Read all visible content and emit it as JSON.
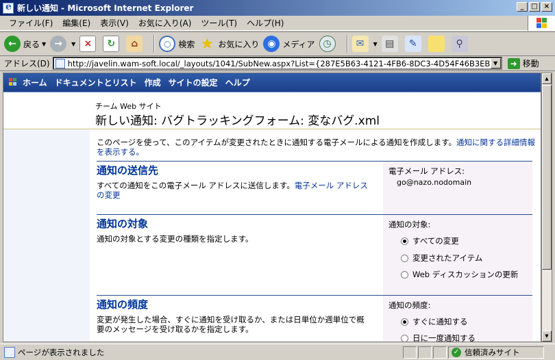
{
  "window": {
    "title": "新しい通知 - Microsoft Internet Explorer"
  },
  "menu": [
    "ファイル(F)",
    "編集(E)",
    "表示(V)",
    "お気に入り(A)",
    "ツール(T)",
    "ヘルプ(H)"
  ],
  "toolbar": {
    "back": "戻る",
    "search": "検索",
    "favorites": "お気に入り",
    "media": "メディア"
  },
  "address": {
    "label": "アドレス(D)",
    "url": "http://javelin.wam-soft.local/_layouts/1041/SubNew.aspx?List={287E5B63-4121-4FB6-8DC3-4D54F46B3EB2}&ID=1",
    "go": "移動"
  },
  "sp_nav": [
    "ホーム",
    "ドキュメントとリスト",
    "作成",
    "サイトの設定",
    "ヘルプ"
  ],
  "header": {
    "site_name": "チーム Web サイト",
    "page_title": "新しい通知: バグトラッキングフォーム: 変なバグ.xml"
  },
  "intro": {
    "text": "このページを使って、このアイテムが変更されたときに通知する電子メールによる通知を作成します。",
    "link": "通知に関する詳細情報を表示する。"
  },
  "sections": {
    "recipient": {
      "title": "通知の送信先",
      "desc": "すべての通知をこの電子メール アドレスに送信します。",
      "link": "電子メール アドレスの変更",
      "field_label": "電子メール アドレス:",
      "field_value": "go@nazo.nodomain"
    },
    "target": {
      "title": "通知の対象",
      "desc": "通知の対象とする変更の種類を指定します。",
      "field_label": "通知の対象:",
      "options": [
        "すべての変更",
        "変更されたアイテム",
        "Web ディスカッションの更新"
      ],
      "selected": 0
    },
    "frequency": {
      "title": "通知の頻度",
      "desc": "変更が発生した場合、すぐに通知を受け取るか、または日単位か週単位で概要のメッセージを受け取るかを指定します。",
      "field_label": "通知の頻度:",
      "options": [
        "すぐに通知する",
        "日に一度通知する"
      ],
      "selected": 0
    }
  },
  "status": {
    "text": "ページが表示されました",
    "zone": "信頼済みサイト"
  }
}
